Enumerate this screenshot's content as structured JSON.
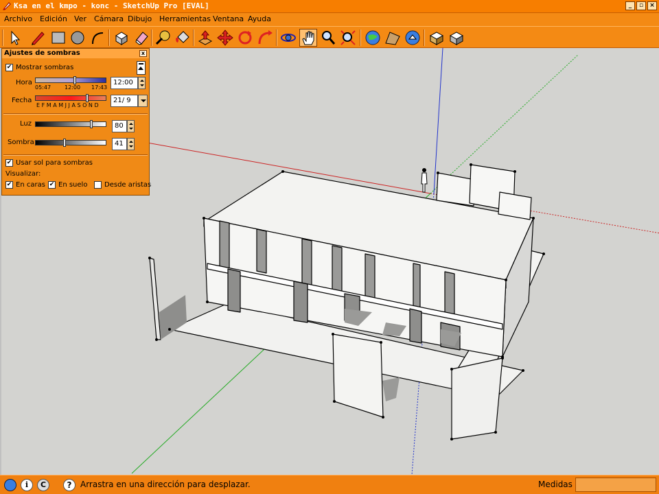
{
  "window": {
    "title": "Ksa en el kmpo - konc - SketchUp Pro [EVAL]",
    "minimize_label": "_",
    "restore_label": "▫",
    "close_label": "×"
  },
  "menu": {
    "items": [
      "Archivo",
      "Edición",
      "Ver",
      "Cámara",
      "Dibujo",
      "Herramientas",
      "Ventana",
      "Ayuda"
    ]
  },
  "toolbar": {
    "tools": [
      {
        "name": "select-tool",
        "icon": "arrow-icon"
      },
      {
        "name": "pencil-tool",
        "icon": "pencil-icon"
      },
      {
        "name": "rectangle-tool",
        "icon": "rectangle-icon"
      },
      {
        "name": "circle-tool",
        "icon": "circle-icon"
      },
      {
        "name": "arc-tool",
        "icon": "arc-icon"
      },
      {
        "name": "make-component-tool",
        "icon": "component-icon"
      },
      {
        "name": "eraser-tool",
        "icon": "eraser-icon"
      },
      {
        "name": "tape-measure-tool",
        "icon": "tape-measure-icon"
      },
      {
        "name": "paint-bucket-tool",
        "icon": "paint-bucket-icon"
      },
      {
        "name": "push-pull-tool",
        "icon": "push-pull-icon"
      },
      {
        "name": "move-tool",
        "icon": "move-icon"
      },
      {
        "name": "rotate-tool",
        "icon": "rotate-icon"
      },
      {
        "name": "follow-me-tool",
        "icon": "follow-me-icon"
      },
      {
        "name": "orbit-tool",
        "icon": "orbit-icon"
      },
      {
        "name": "pan-tool",
        "icon": "hand-icon"
      },
      {
        "name": "zoom-tool",
        "icon": "magnifier-icon"
      },
      {
        "name": "zoom-extents-tool",
        "icon": "zoom-extents-icon"
      },
      {
        "name": "get-current-view-tool",
        "icon": "globe-view-icon"
      },
      {
        "name": "toggle-terrain-tool",
        "icon": "terrain-icon"
      },
      {
        "name": "place-model-tool",
        "icon": "globe-place-icon"
      },
      {
        "name": "get-models-tool",
        "icon": "warehouse-get-icon"
      },
      {
        "name": "share-model-tool",
        "icon": "warehouse-share-icon"
      }
    ]
  },
  "shadow_panel": {
    "title": "Ajustes de sombras",
    "close_label": "x",
    "show_shadows_label": "Mostrar sombras",
    "show_shadows_checked": true,
    "hora_label": "Hora",
    "hora_ticks": [
      "05:47",
      "12:00",
      "17:43"
    ],
    "hora_value": "12:00",
    "fecha_label": "Fecha",
    "fecha_months": "E F M A M J  J A S O N D",
    "fecha_value": "21/ 9",
    "luz_label": "Luz",
    "luz_value": "80",
    "sombra_label": "Sombra",
    "sombra_value": "41",
    "use_sun_label": "Usar sol para sombras",
    "use_sun_checked": true,
    "visualizar_label": "Visualizar:",
    "en_caras_label": "En caras",
    "en_caras_checked": true,
    "en_suelo_label": "En suelo",
    "en_suelo_checked": true,
    "desde_aristas_label": "Desde aristas",
    "desde_aristas_checked": false
  },
  "statusbar": {
    "hint": "Arrastra en una dirección para desplazar.",
    "measure_label": "Medidas",
    "measure_value": ""
  },
  "colors": {
    "chrome_orange": "#f08010",
    "viewport_bg": "#d3d3d0",
    "axis_red": "#cc2222",
    "axis_green": "#22aa22",
    "axis_blue": "#2233cc"
  }
}
